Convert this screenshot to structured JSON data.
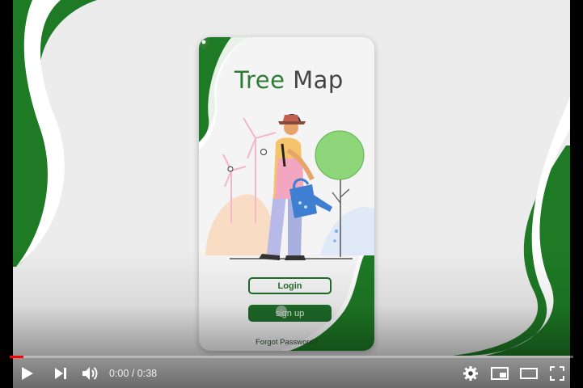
{
  "app": {
    "title_part1": "Tree",
    "title_part2": "Map",
    "login_label": "Login",
    "signup_label": "sign up",
    "forgot_label": "Forgot Password?"
  },
  "player": {
    "current_time": "0:00",
    "separator": " / ",
    "duration": "0:38",
    "progress_fraction": 0.025,
    "progress_color": "#ff0000"
  },
  "colors": {
    "brand_green": "#1f6e2a",
    "background": "#ececec"
  },
  "icons": [
    "play-icon",
    "next-icon",
    "volume-icon",
    "settings-icon",
    "miniplayer-icon",
    "theater-icon",
    "fullscreen-icon",
    "map-pin-icon"
  ]
}
